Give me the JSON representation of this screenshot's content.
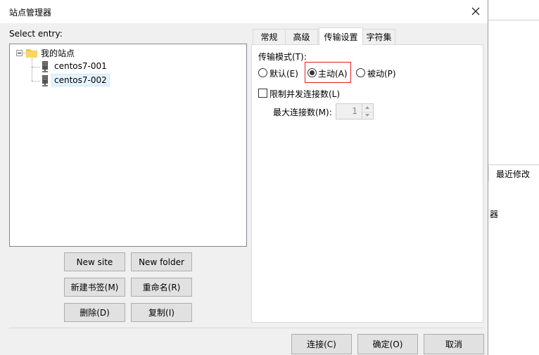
{
  "dialog": {
    "title": "站点管理器"
  },
  "background": {
    "column_header": "最近修改",
    "fragment_text": "器"
  },
  "left_panel": {
    "select_label": "Select entry:",
    "tree": {
      "root": {
        "label": "我的站点",
        "icon": "folder-icon"
      },
      "sites": [
        {
          "label": "centos7-001",
          "icon": "server-icon",
          "selected": false
        },
        {
          "label": "centos7-002",
          "icon": "server-icon",
          "selected": true
        }
      ]
    },
    "buttons": {
      "new_site": "New site",
      "new_folder": "New folder",
      "new_bookmark": "新建书签(M)",
      "rename": "重命名(R)",
      "delete": "删除(D)",
      "copy": "复制(I)"
    }
  },
  "tabs": [
    {
      "label": "常规",
      "active": false
    },
    {
      "label": "高级",
      "active": false
    },
    {
      "label": "传输设置",
      "active": true
    },
    {
      "label": "字符集",
      "active": false
    }
  ],
  "transfer_settings": {
    "mode_label": "传输模式(T):",
    "modes": [
      {
        "label": "默认(E)",
        "checked": false
      },
      {
        "label": "主动(A)",
        "checked": true
      },
      {
        "label": "被动(P)",
        "checked": false
      }
    ],
    "limit_checkbox_label": "限制并发连接数(L)",
    "limit_checked": false,
    "max_connections_label": "最大连接数(M):",
    "max_connections_value": "1"
  },
  "footer": {
    "connect": "连接(C)",
    "ok": "确定(O)",
    "cancel": "取消"
  },
  "colors": {
    "highlight_box": "#e02020",
    "folder": "#f2c744",
    "dialog_bg": "#f0f0f0"
  }
}
